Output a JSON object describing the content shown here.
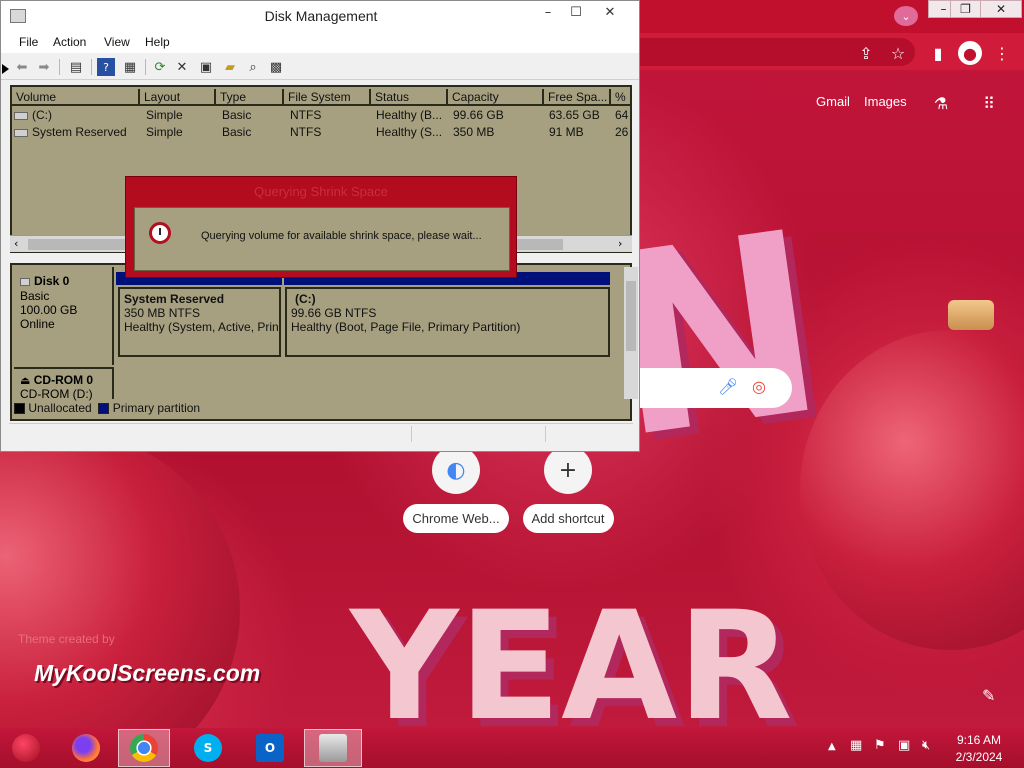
{
  "disk_management": {
    "title": "Disk Management",
    "menu": [
      "File",
      "Action",
      "View",
      "Help"
    ],
    "columns": [
      "Volume",
      "Layout",
      "Type",
      "File System",
      "Status",
      "Capacity",
      "Free Spa...",
      "% F"
    ],
    "volumes": [
      {
        "volume": "(C:)",
        "layout": "Simple",
        "type": "Basic",
        "fs": "NTFS",
        "status": "Healthy (B...",
        "capacity": "99.66 GB",
        "free": "63.65 GB",
        "pct": "64"
      },
      {
        "volume": "System Reserved",
        "layout": "Simple",
        "type": "Basic",
        "fs": "NTFS",
        "status": "Healthy (S...",
        "capacity": "350 MB",
        "free": "91 MB",
        "pct": "26"
      }
    ],
    "disk0": {
      "name": "Disk 0",
      "type": "Basic",
      "size": "100.00 GB",
      "state": "Online",
      "partitions": [
        {
          "name": "System Reserved",
          "size": "350 MB NTFS",
          "status": "Healthy (System, Active, Prin"
        },
        {
          "name": "(C:)",
          "size": "99.66 GB NTFS",
          "status": "Healthy (Boot, Page File, Primary Partition)"
        }
      ]
    },
    "cdrom": {
      "name": "CD-ROM 0",
      "drive": "CD-ROM (D:)"
    },
    "legend": [
      {
        "label": "Unallocated",
        "color": "#000000"
      },
      {
        "label": "Primary partition",
        "color": "#00107a"
      }
    ],
    "dialog": {
      "title": "Querying Shrink Space",
      "message": "Querying volume for available shrink space, please wait..."
    }
  },
  "chrome": {
    "links": [
      "Gmail",
      "Images"
    ],
    "shortcuts": [
      {
        "label": "Chrome Web...",
        "icon": "chrome-web-store-icon"
      },
      {
        "label": "Add shortcut",
        "icon": "plus-icon"
      }
    ]
  },
  "wallpaper": {
    "credit": "Theme created by",
    "brand": "MyKoolScreens.com",
    "letters": [
      "N",
      "YEAR"
    ]
  },
  "taskbar": {
    "apps": [
      "start-ornament",
      "firefox",
      "chrome",
      "skype",
      "outlook",
      "disk-management"
    ],
    "time": "9:16 AM",
    "date": "2/3/2024"
  }
}
